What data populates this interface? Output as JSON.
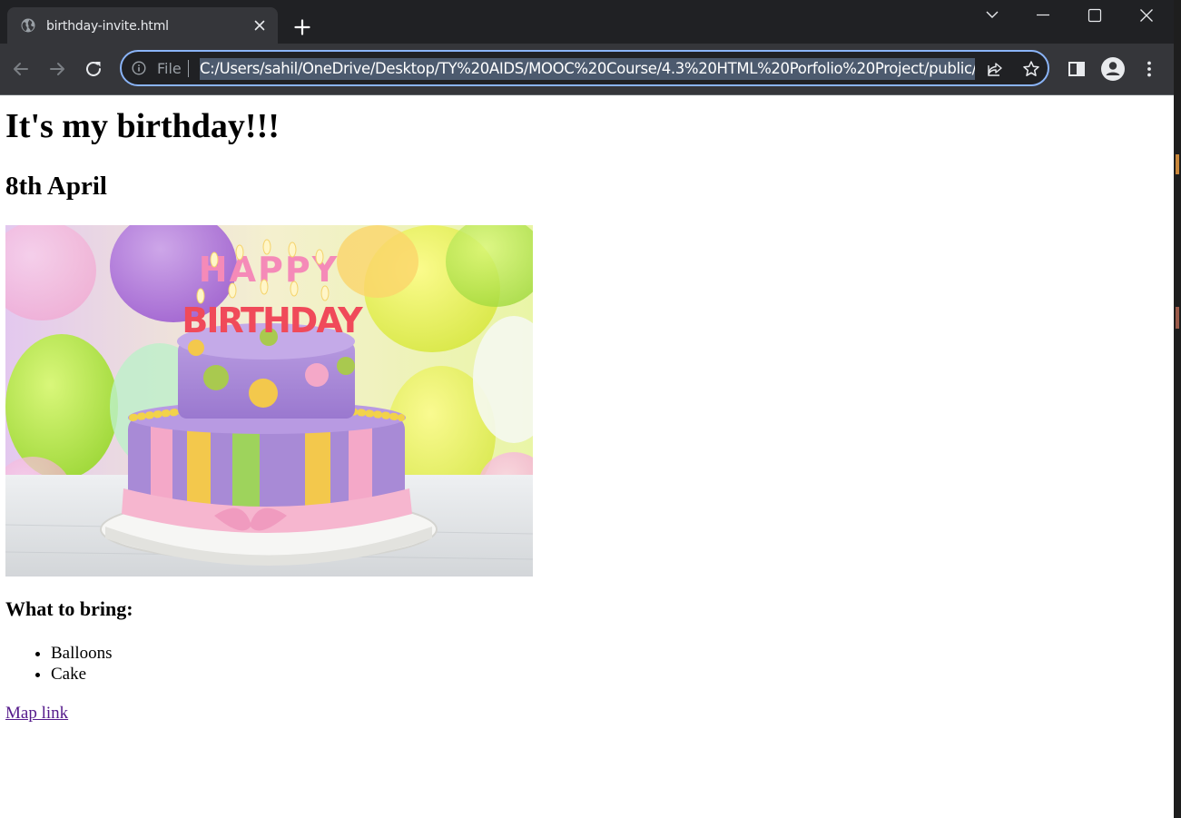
{
  "browser": {
    "tab": {
      "title": "birthday-invite.html",
      "favicon": "globe-icon"
    },
    "omnibox": {
      "scheme_label": "File",
      "url": "C:/Users/sahil/OneDrive/Desktop/TY%20AIDS/MOOC%20Course/4.3%20HTML%20Porfolio%20Project/public/birthday-invite.html"
    },
    "theme": {
      "frame": "#202124",
      "toolbar": "#35363a",
      "focus_ring": "#8ab4f8"
    }
  },
  "page": {
    "heading": "It's my birthday!!!",
    "date": "8th April",
    "image": {
      "alt": "birthday-cake",
      "subject": "cake-with-happy-birthday-candles",
      "cake_text": "HAPPY BIRTHDAY"
    },
    "bring_heading": "What to bring:",
    "items": [
      "Balloons",
      "Cake"
    ],
    "link_text": "Map link",
    "link_color": "#551a8b"
  }
}
